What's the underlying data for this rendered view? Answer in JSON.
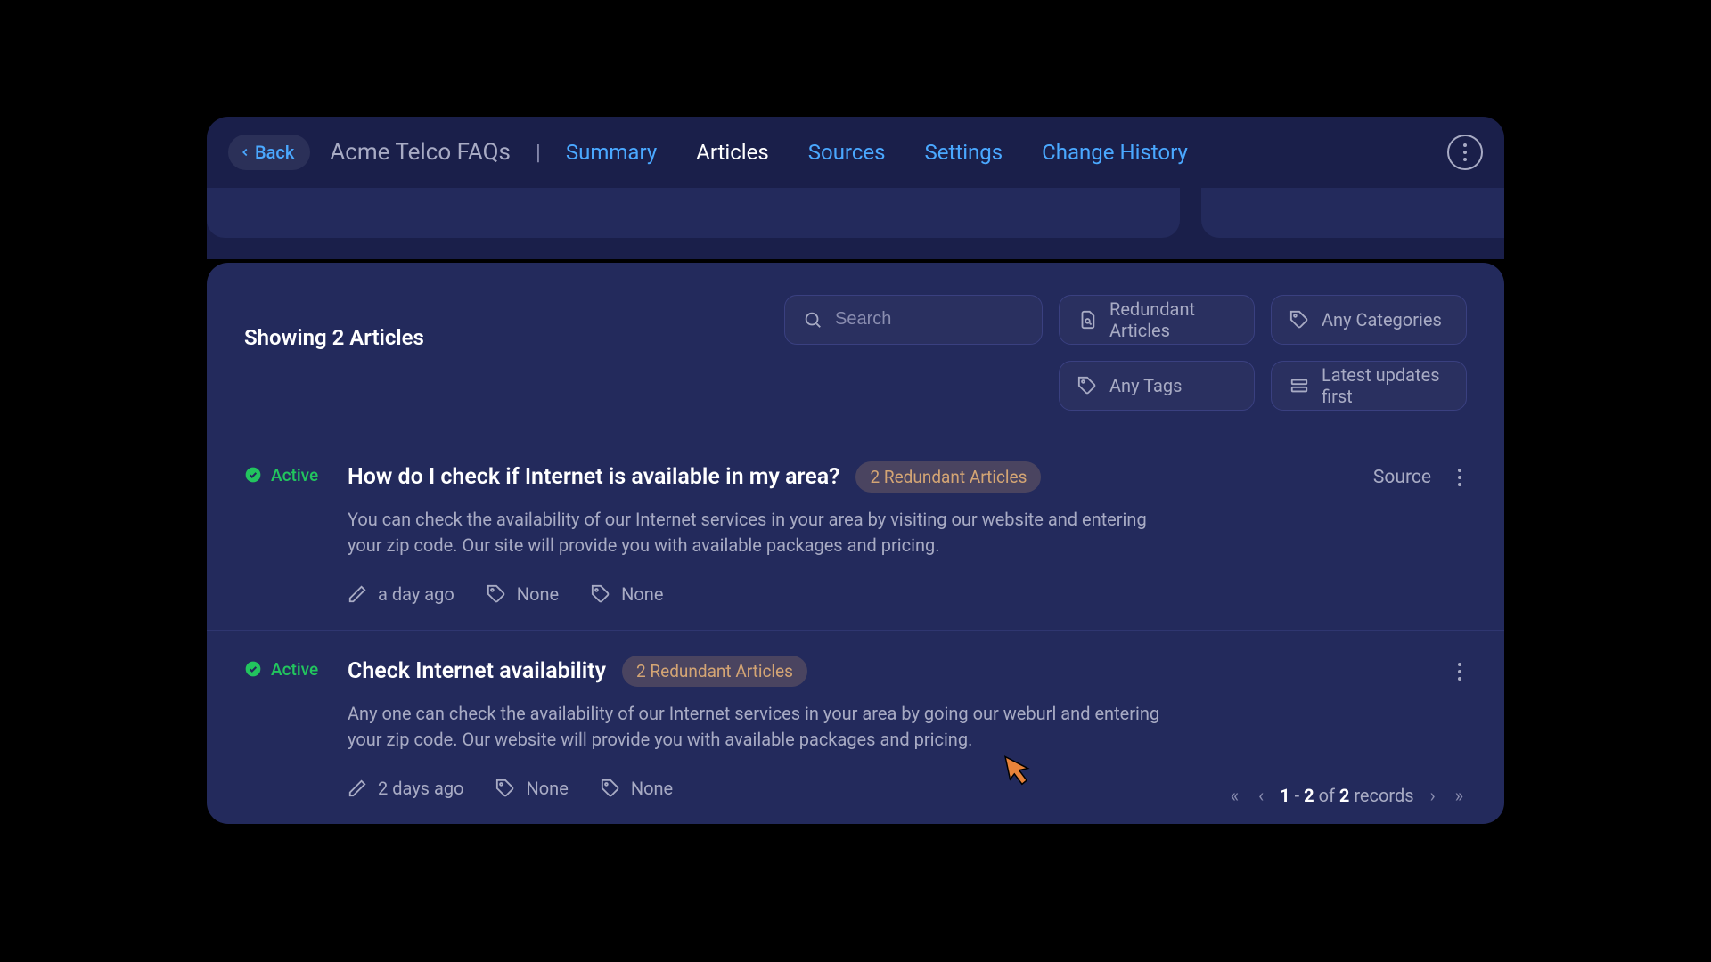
{
  "header": {
    "back_label": "Back",
    "title": "Acme Telco FAQs",
    "tabs": [
      {
        "label": "Summary",
        "active": false
      },
      {
        "label": "Articles",
        "active": true
      },
      {
        "label": "Sources",
        "active": false
      },
      {
        "label": "Settings",
        "active": false
      },
      {
        "label": "Change History",
        "active": false
      }
    ]
  },
  "toolbar": {
    "count_text": "Showing 2 Articles",
    "search_placeholder": "Search",
    "filters": {
      "redundant": "Redundant Articles",
      "categories": "Any Categories",
      "tags": "Any Tags",
      "sort": "Latest updates first"
    }
  },
  "articles": [
    {
      "status": "Active",
      "title": "How do I check if Internet is available in my area?",
      "redundant_badge": "2 Redundant Articles",
      "description": "You can check the availability of our Internet services in your area by visiting our website and entering your zip code. Our site will provide you with available packages and pricing.",
      "updated": "a day ago",
      "tags": "None",
      "categories": "None",
      "source_label": "Source",
      "show_source": true
    },
    {
      "status": "Active",
      "title": "Check Internet availability",
      "redundant_badge": "2 Redundant Articles",
      "description": "Any one can check the availability of our Internet services in your area by going our weburl and entering your zip code. Our website will provide you with available packages and pricing.",
      "updated": "2 days ago",
      "tags": "None",
      "categories": "None",
      "source_label": "",
      "show_source": false
    }
  ],
  "pagination": {
    "range_start": "1",
    "range_end": "2",
    "of_word": "of",
    "total": "2",
    "records_word": "records"
  }
}
